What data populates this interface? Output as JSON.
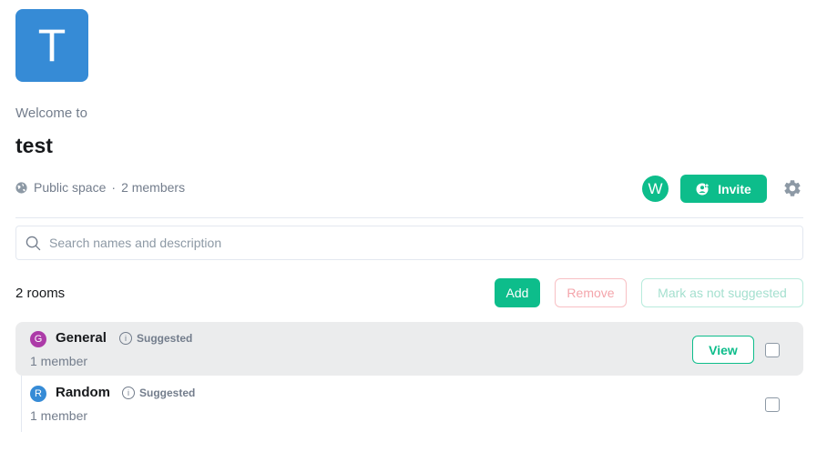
{
  "space": {
    "avatar_letter": "T",
    "avatar_color": "#368bd6",
    "welcome_text": "Welcome to",
    "name": "test",
    "visibility": "Public space",
    "separator": "·",
    "member_count": "2 members"
  },
  "header_actions": {
    "member_avatar_letter": "W",
    "member_avatar_color": "#0dbd8b",
    "invite_label": "Invite"
  },
  "search": {
    "placeholder": "Search names and description",
    "value": ""
  },
  "rooms_toolbar": {
    "count_label": "2 rooms",
    "add_label": "Add",
    "remove_label": "Remove",
    "mark_label": "Mark as not suggested"
  },
  "rooms": [
    {
      "avatar_letter": "G",
      "avatar_color": "#ac3ba8",
      "name": "General",
      "badge": "Suggested",
      "members": "1 member",
      "view_label": "View",
      "checked": false
    },
    {
      "avatar_letter": "R",
      "avatar_color": "#368bd6",
      "name": "Random",
      "badge": "Suggested",
      "members": "1 member",
      "checked": false
    }
  ],
  "colors": {
    "accent": "#0dbd8b",
    "danger_outline": "#f8c0c4",
    "muted_text": "#737d8c"
  }
}
